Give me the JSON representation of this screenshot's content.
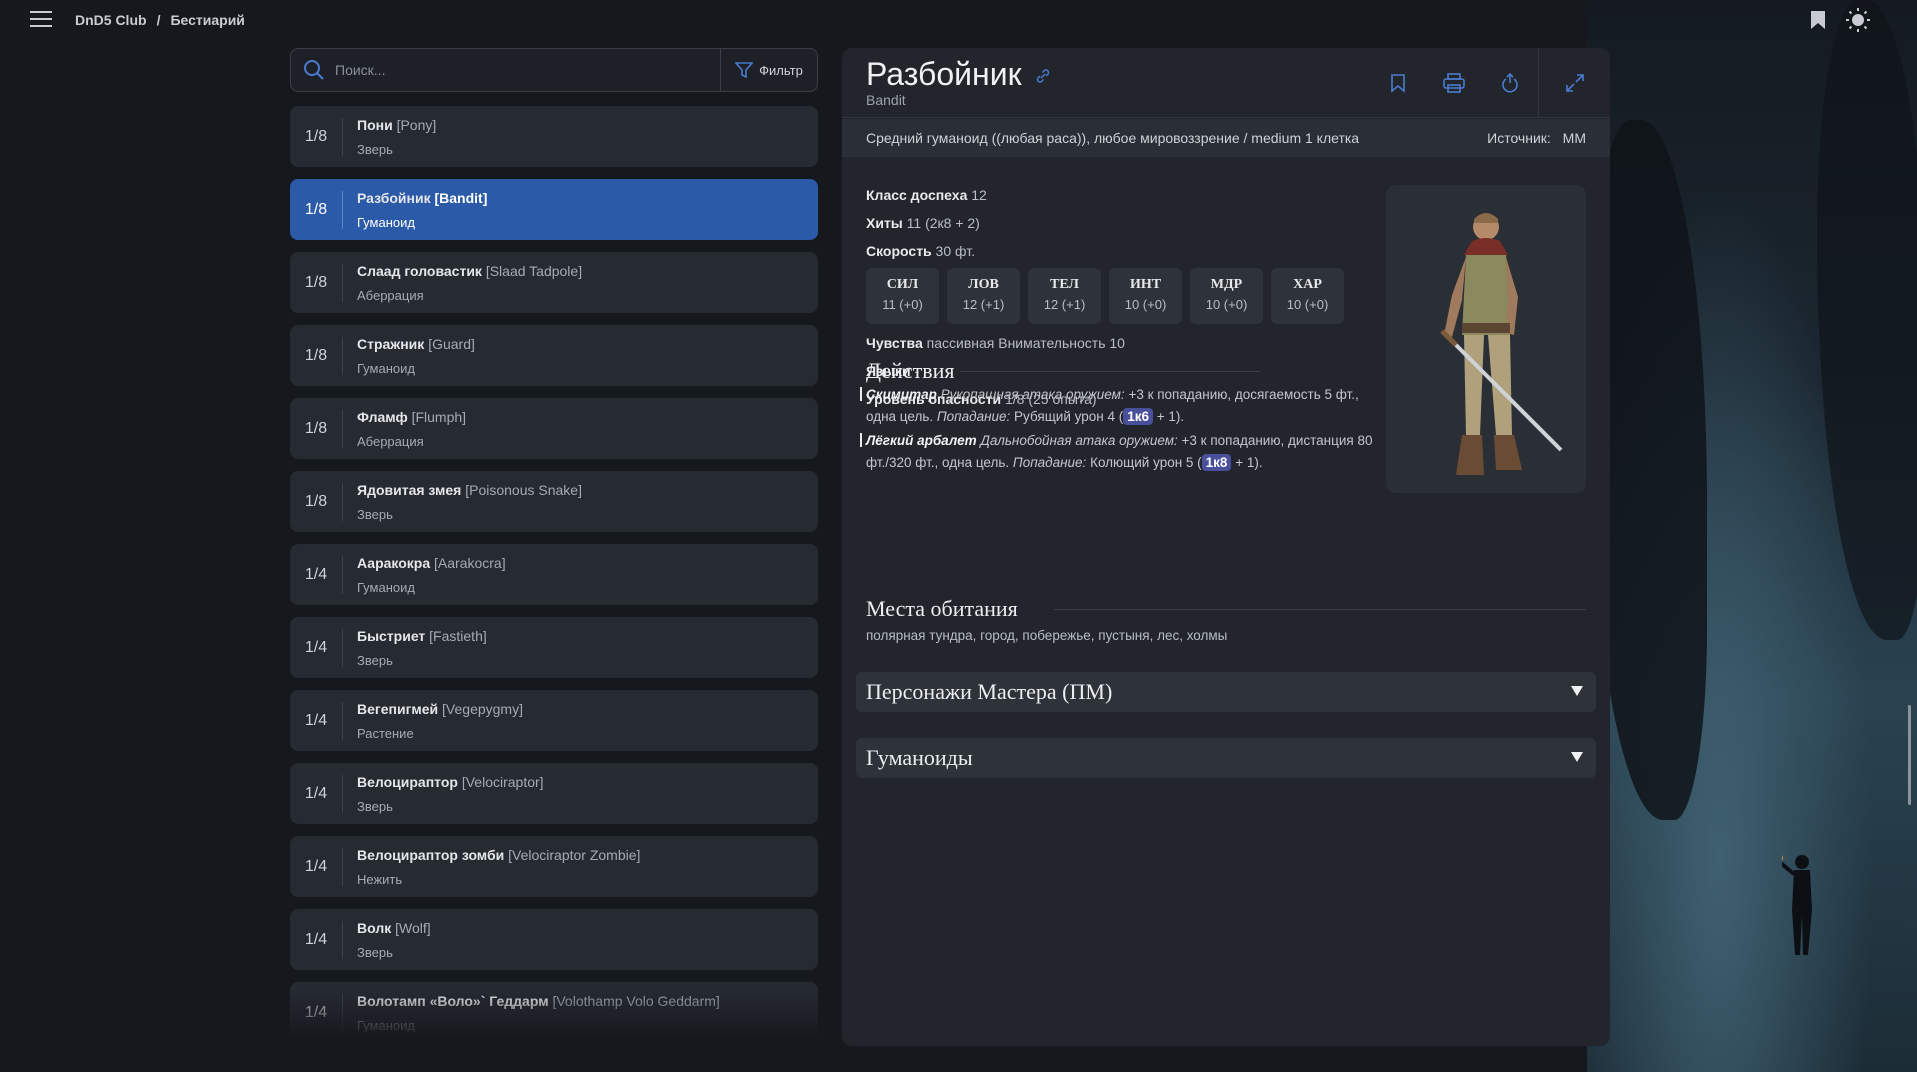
{
  "topbar": {
    "site": "DnD5 Club",
    "separator": "/",
    "section": "Бестиарий"
  },
  "search": {
    "placeholder": "Поиск...",
    "filter_label": "Фильтр"
  },
  "list": [
    {
      "cr": "1/8",
      "name": "Пони",
      "en": "[Pony]",
      "type": "Зверь",
      "active": false
    },
    {
      "cr": "1/8",
      "name": "Разбойник",
      "en": "[Bandit]",
      "type": "Гуманоид",
      "active": true
    },
    {
      "cr": "1/8",
      "name": "Слаад головастик",
      "en": "[Slaad Tadpole]",
      "type": "Аберрация",
      "active": false
    },
    {
      "cr": "1/8",
      "name": "Стражник",
      "en": "[Guard]",
      "type": "Гуманоид",
      "active": false
    },
    {
      "cr": "1/8",
      "name": "Фламф",
      "en": "[Flumph]",
      "type": "Аберрация",
      "active": false
    },
    {
      "cr": "1/8",
      "name": "Ядовитая змея",
      "en": "[Poisonous Snake]",
      "type": "Зверь",
      "active": false
    },
    {
      "cr": "1/4",
      "name": "Ааракокра",
      "en": "[Aarakocra]",
      "type": "Гуманоид",
      "active": false
    },
    {
      "cr": "1/4",
      "name": "Быстриет",
      "en": "[Fastieth]",
      "type": "Зверь",
      "active": false
    },
    {
      "cr": "1/4",
      "name": "Вегепигмей",
      "en": "[Vegepygmy]",
      "type": "Растение",
      "active": false
    },
    {
      "cr": "1/4",
      "name": "Велоцираптор",
      "en": "[Velociraptor]",
      "type": "Зверь",
      "active": false
    },
    {
      "cr": "1/4",
      "name": "Велоцираптор зомби",
      "en": "[Velociraptor Zombie]",
      "type": "Нежить",
      "active": false
    },
    {
      "cr": "1/4",
      "name": "Волк",
      "en": "[Wolf]",
      "type": "Зверь",
      "active": false
    },
    {
      "cr": "1/4",
      "name": "Волотамп «Воло»` Геддарм",
      "en": "[Volothamp Volo Geddarm]",
      "type": "Гуманоид",
      "active": false
    }
  ],
  "detail": {
    "title": "Разбойник",
    "subtitle": "Bandit",
    "description": "Средний гуманоид ((любая раса)), любое мировоззрение / medium 1 клетка",
    "source_label": "Источник:",
    "source_value": "MM",
    "armor_label": "Класс доспеха",
    "armor_value": "12",
    "hp_label": "Хиты",
    "hp_value": "11 (2к8 + 2)",
    "speed_label": "Скорость",
    "speed_value": "30 фт.",
    "abilities": [
      {
        "name": "СИЛ",
        "value": "11 (+0)"
      },
      {
        "name": "ЛОВ",
        "value": "12 (+1)"
      },
      {
        "name": "ТЕЛ",
        "value": "12 (+1)"
      },
      {
        "name": "ИНТ",
        "value": "10 (+0)"
      },
      {
        "name": "МДР",
        "value": "10 (+0)"
      },
      {
        "name": "ХАР",
        "value": "10 (+0)"
      }
    ],
    "senses_label": "Чувства",
    "senses_value": "пассивная Внимательность 10",
    "languages_label": "Языки",
    "languages_value": "-",
    "challenge_label": "Уровень опасности",
    "challenge_value": "1/8 (25 опыта)",
    "actions_title": "Действия",
    "actions": [
      {
        "name": "Скимитар",
        "attack_type": "Рукопашная атака оружием:",
        "text1": "+3 к попаданию, досягаемость 5 фт., одна цель.",
        "hit_label": "Попадание:",
        "text2": "Рубящий урон 4 (",
        "dice": "1к6",
        "text3": "+ 1)."
      },
      {
        "name": "Лёгкий арбалет",
        "attack_type": "Дальнобойная атака оружием:",
        "text1": "+3 к попаданию, дистанция 80 фт./320 фт., одна цель.",
        "hit_label": "Попадание:",
        "text2": "Колющий урон 5 (",
        "dice": "1к8",
        "text3": "+ 1)."
      }
    ],
    "habitat_title": "Места обитания",
    "habitat_value": "полярная тундра, город, побережье, пустыня, лес, холмы",
    "collapse_1": "Персонажи Мастера (ПМ)",
    "collapse_2": "Гуманоиды"
  },
  "colors": {
    "accent": "#2b5aa8",
    "dice": "#4a4f9c",
    "background": "#15181d",
    "card": "#22262c"
  },
  "icons": [
    "menu-icon",
    "bookmark-icon",
    "theme-sun-icon",
    "search-icon",
    "filter-icon",
    "link-icon",
    "print-icon",
    "share-icon",
    "expand-icon",
    "chevron-down-icon"
  ]
}
